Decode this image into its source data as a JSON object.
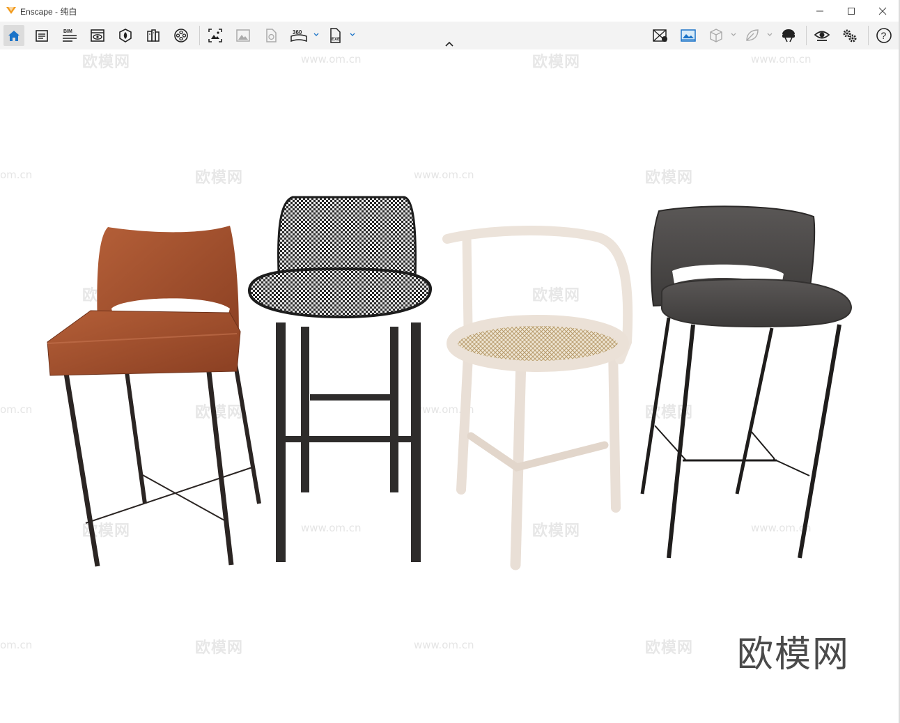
{
  "window": {
    "title": "Enscape - 纯白",
    "controls": [
      "minimize",
      "maximize",
      "close"
    ]
  },
  "toolbar": {
    "left_tools": [
      {
        "icon": "home-icon",
        "active": true
      },
      {
        "icon": "notes-icon"
      },
      {
        "icon": "bim-icon",
        "label": "BIM"
      },
      {
        "icon": "view-management-icon"
      },
      {
        "icon": "material-editor-icon"
      },
      {
        "icon": "asset-library-icon"
      },
      {
        "icon": "video-editor-icon"
      },
      {
        "icon": "screenshot-icon"
      },
      {
        "icon": "batch-render-icon"
      },
      {
        "icon": "export-web-icon"
      },
      {
        "icon": "panorama-icon",
        "label": "360"
      },
      {
        "icon": "export-exe-icon",
        "label": "EXE"
      }
    ],
    "right_tools": [
      {
        "icon": "sync-views-icon"
      },
      {
        "icon": "visual-settings-icon",
        "highlighted": true
      },
      {
        "icon": "orthographic-cube-icon"
      },
      {
        "icon": "vr-leaf-icon"
      },
      {
        "icon": "vr-headset-icon"
      },
      {
        "icon": "live-view-eye-icon"
      },
      {
        "icon": "settings-gears-icon"
      },
      {
        "icon": "help-icon",
        "label": "?"
      }
    ],
    "collapse_icon": "chevron-up-icon"
  },
  "viewport": {
    "watermark_text": "欧模网",
    "watermark_url": "www.om.cn",
    "watermark_url_partial": "om.cn",
    "brand_logo_text": "欧模网",
    "chairs": [
      {
        "name": "leather-bar-chair",
        "color": "#9a4a2a"
      },
      {
        "name": "houndstooth-bar-stool",
        "color": "#2a2a2a"
      },
      {
        "name": "white-wood-rattan-chair",
        "color": "#e8dcd2"
      },
      {
        "name": "gray-fabric-bar-chair",
        "color": "#4a4746"
      }
    ]
  },
  "colors": {
    "accent": "#1a73c8",
    "logo_orange": "#f29b1d",
    "toolbar_bg": "#f3f3f3"
  }
}
